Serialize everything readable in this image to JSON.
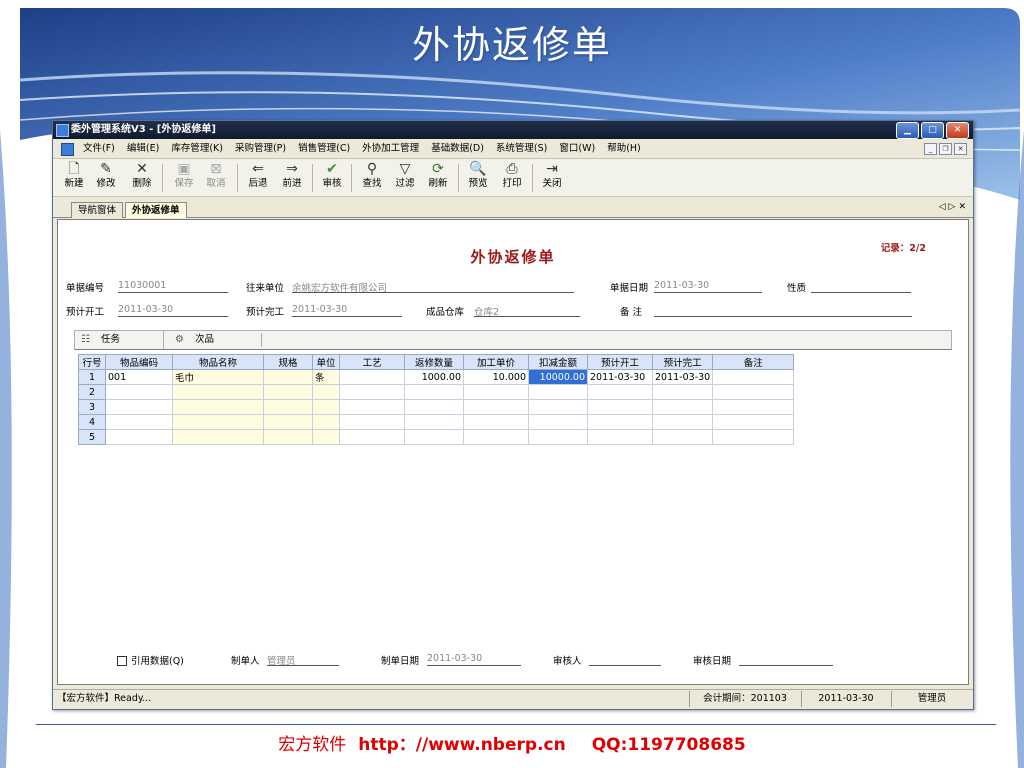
{
  "slide": {
    "title": "外协返修单",
    "footer_brand": "宏方软件",
    "footer_url": "http：//www.nberp.cn",
    "footer_qq": "QQ:1197708685"
  },
  "window": {
    "title": "委外管理系统V3 - [外协返修单]",
    "controls": [
      "minimize",
      "maximize",
      "close"
    ]
  },
  "menu": [
    "文件(F)",
    "编辑(E)",
    "库存管理(K)",
    "采购管理(P)",
    "销售管理(C)",
    "外协加工管理",
    "基础数据(D)",
    "系统管理(S)",
    "窗口(W)",
    "帮助(H)"
  ],
  "toolbar": {
    "new": "新建",
    "edit": "修改",
    "delete": "删除",
    "save": "保存",
    "cancel": "取消",
    "back": "后退",
    "forward": "前进",
    "audit": "审核",
    "find": "查找",
    "filter": "过滤",
    "refresh": "刷新",
    "preview": "预览",
    "print": "打印",
    "close": "关闭"
  },
  "tabs": {
    "nav": "导航窗体",
    "current": "外协返修单"
  },
  "form": {
    "title": "外协返修单",
    "record": "记录：2/2",
    "doc_no_label": "单据编号",
    "doc_no": "11030001",
    "partner_label": "往来单位",
    "partner": "余姚宏方软件有限公司",
    "doc_date_label": "单据日期",
    "doc_date": "2011-03-30",
    "nature_label": "性质",
    "nature": "",
    "plan_start_label": "预计开工",
    "plan_start": "2011-03-30",
    "plan_end_label": "预计完工",
    "plan_end": "2011-03-30",
    "warehouse_label": "成品仓库",
    "warehouse": "仓库2",
    "remark_label": "备  注",
    "remark": ""
  },
  "subtabs": {
    "task": "任务",
    "defect": "次品"
  },
  "grid": {
    "headers": [
      "行号",
      "物品编码",
      "物品名称",
      "规格",
      "单位",
      "工艺",
      "返修数量",
      "加工单价",
      "扣减金额",
      "预计开工",
      "预计完工",
      "备注"
    ],
    "rows": [
      [
        "1",
        "001",
        "毛巾",
        "",
        "条",
        "",
        "1000.00",
        "10.000",
        "10000.00",
        "2011-03-30",
        "2011-03-30",
        ""
      ],
      [
        "2",
        "",
        "",
        "",
        "",
        "",
        "",
        "",
        "",
        "",
        "",
        ""
      ],
      [
        "3",
        "",
        "",
        "",
        "",
        "",
        "",
        "",
        "",
        "",
        "",
        ""
      ],
      [
        "4",
        "",
        "",
        "",
        "",
        "",
        "",
        "",
        "",
        "",
        "",
        ""
      ],
      [
        "5",
        "",
        "",
        "",
        "",
        "",
        "",
        "",
        "",
        "",
        "",
        ""
      ]
    ]
  },
  "bottom": {
    "ref_data_label": "引用数据(Q)",
    "maker_label": "制单人",
    "maker": "管理员",
    "make_date_label": "制单日期",
    "make_date": "2011-03-30",
    "auditor_label": "审核人",
    "auditor": "",
    "audit_date_label": "审核日期",
    "audit_date": ""
  },
  "status": {
    "left": "【宏方软件】Ready...",
    "period": "会计期间：201103",
    "date": "2011-03-30",
    "user": "管理员"
  }
}
